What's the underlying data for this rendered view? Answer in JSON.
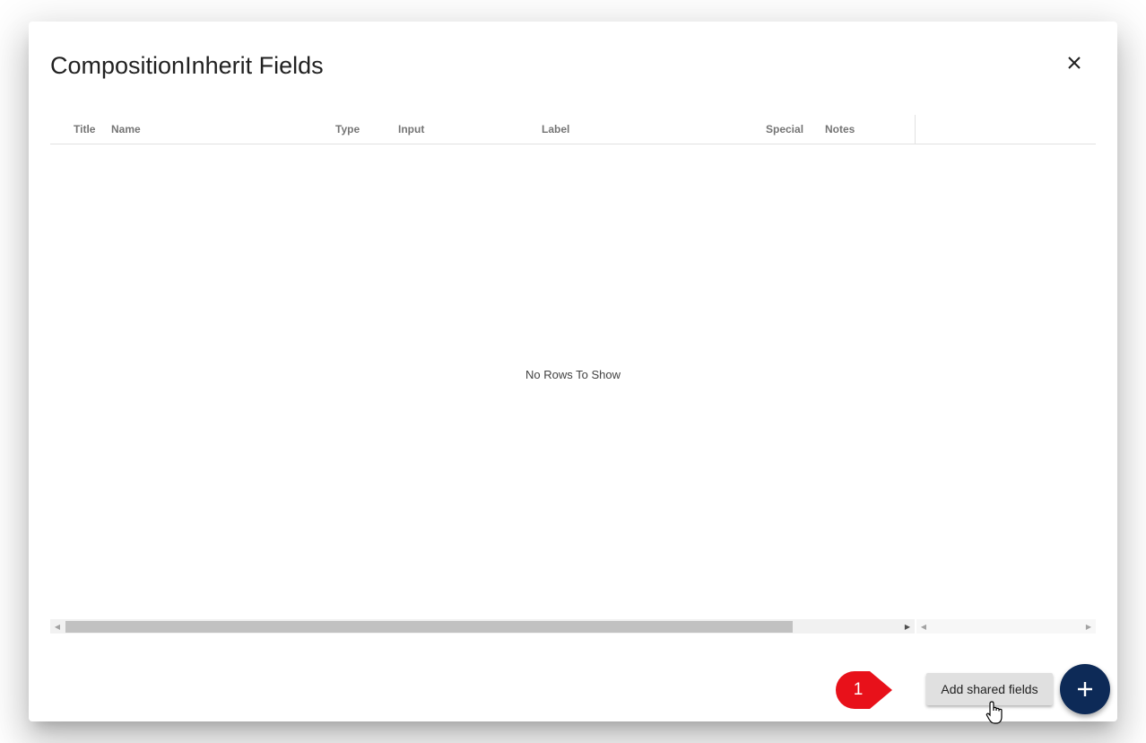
{
  "dialog": {
    "title": "CompositionInherit Fields",
    "close_icon": "close-icon"
  },
  "grid": {
    "columns": [
      "Title",
      "Name",
      "Type",
      "Input",
      "Label",
      "Special",
      "Notes"
    ],
    "empty_message": "No Rows To Show"
  },
  "callout": {
    "number": "1",
    "color": "#e8111a"
  },
  "actions": {
    "add_shared_label": "Add shared fields",
    "fab_icon": "plus-icon",
    "fab_color": "#0d2a57"
  }
}
